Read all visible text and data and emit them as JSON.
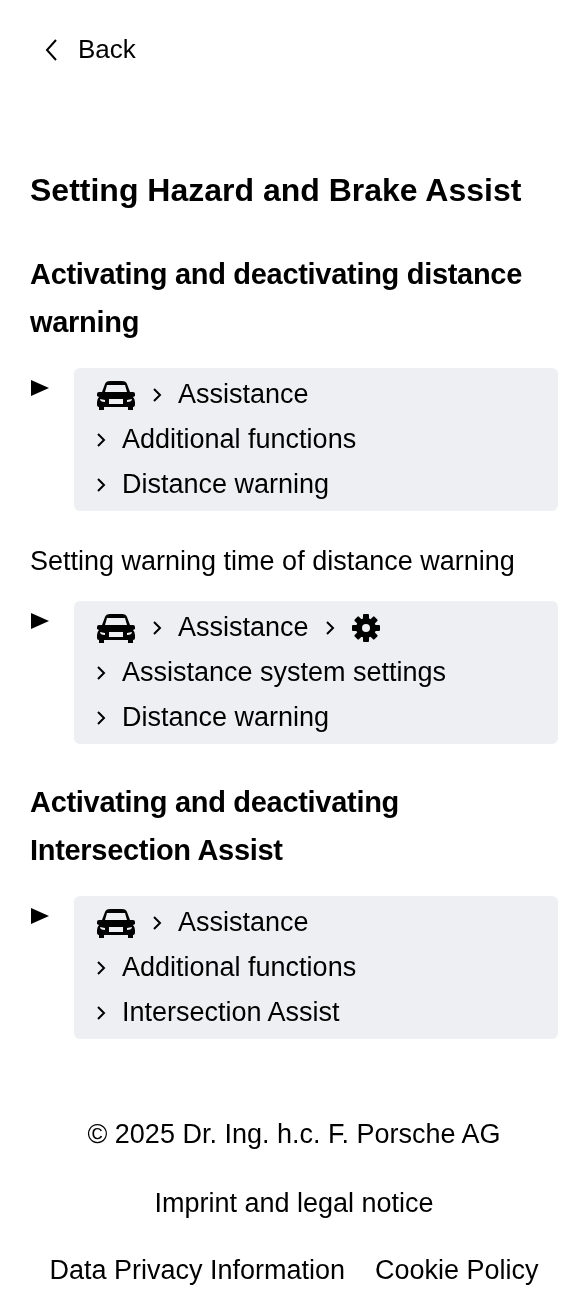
{
  "header": {
    "back_label": "Back"
  },
  "title": "Setting Hazard and Brake Assist",
  "sections": [
    {
      "kind": "heading",
      "text": "Activating and deactivating distance warning"
    },
    {
      "kind": "path",
      "lines": [
        [
          {
            "kind": "car"
          },
          {
            "kind": "text",
            "text": "Assistance"
          }
        ],
        [
          {
            "kind": "text",
            "text": "Additional functions"
          }
        ],
        [
          {
            "kind": "text",
            "text": "Distance warning"
          }
        ]
      ]
    },
    {
      "kind": "paragraph",
      "text": "Setting warning time of distance warning"
    },
    {
      "kind": "path",
      "lines": [
        [
          {
            "kind": "car"
          },
          {
            "kind": "text",
            "text": "Assistance"
          },
          {
            "kind": "gear"
          }
        ],
        [
          {
            "kind": "text",
            "text": "Assistance system settings"
          }
        ],
        [
          {
            "kind": "text",
            "text": "Distance warning"
          }
        ]
      ]
    },
    {
      "kind": "heading",
      "text": "Activating and deactivating Intersection Assist"
    },
    {
      "kind": "path",
      "lines": [
        [
          {
            "kind": "car"
          },
          {
            "kind": "text",
            "text": "Assistance"
          }
        ],
        [
          {
            "kind": "text",
            "text": "Additional functions"
          }
        ],
        [
          {
            "kind": "text",
            "text": "Intersection Assist"
          }
        ]
      ]
    }
  ],
  "footer": {
    "copyright": "© 2025 Dr. Ing. h.c. F. Porsche AG",
    "links": [
      {
        "text": "Imprint and legal notice"
      }
    ],
    "bottom_links": [
      {
        "text": "Data Privacy Information"
      },
      {
        "text": "Cookie Policy"
      }
    ]
  }
}
